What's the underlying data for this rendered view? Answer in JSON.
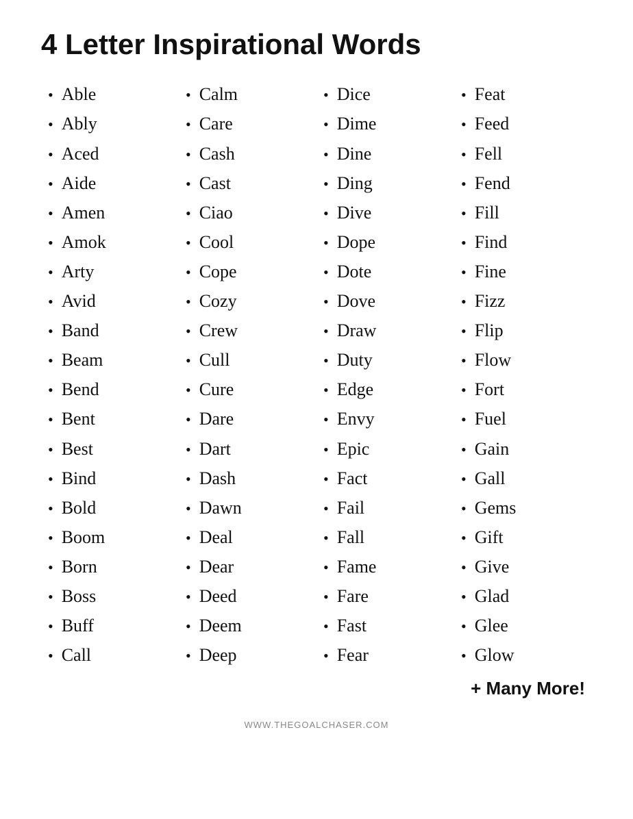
{
  "title": "4 Letter Inspirational Words",
  "columns": [
    {
      "words": [
        "Able",
        "Ably",
        "Aced",
        "Aide",
        "Amen",
        "Amok",
        "Arty",
        "Avid",
        "Band",
        "Beam",
        "Bend",
        "Bent",
        "Best",
        "Bind",
        "Bold",
        "Boom",
        "Born",
        "Boss",
        "Buff",
        "Call"
      ]
    },
    {
      "words": [
        "Calm",
        "Care",
        "Cash",
        "Cast",
        "Ciao",
        "Cool",
        "Cope",
        "Cozy",
        "Crew",
        "Cull",
        "Cure",
        "Dare",
        "Dart",
        "Dash",
        "Dawn",
        "Deal",
        "Dear",
        "Deed",
        "Deem",
        "Deep"
      ]
    },
    {
      "words": [
        "Dice",
        "Dime",
        "Dine",
        "Ding",
        "Dive",
        "Dope",
        "Dote",
        "Dove",
        "Draw",
        "Duty",
        "Edge",
        "Envy",
        "Epic",
        "Fact",
        "Fail",
        "Fall",
        "Fame",
        "Fare",
        "Fast",
        "Fear"
      ]
    },
    {
      "words": [
        "Feat",
        "Feed",
        "Fell",
        "Fend",
        "Fill",
        "Find",
        "Fine",
        "Fizz",
        "Flip",
        "Flow",
        "Fort",
        "Fuel",
        "Gain",
        "Gall",
        "Gems",
        "Gift",
        "Give",
        "Glad",
        "Glee",
        "Glow"
      ]
    }
  ],
  "more_label": "+ Many More!",
  "footer": "WWW.THEGOALCHASER.COM"
}
